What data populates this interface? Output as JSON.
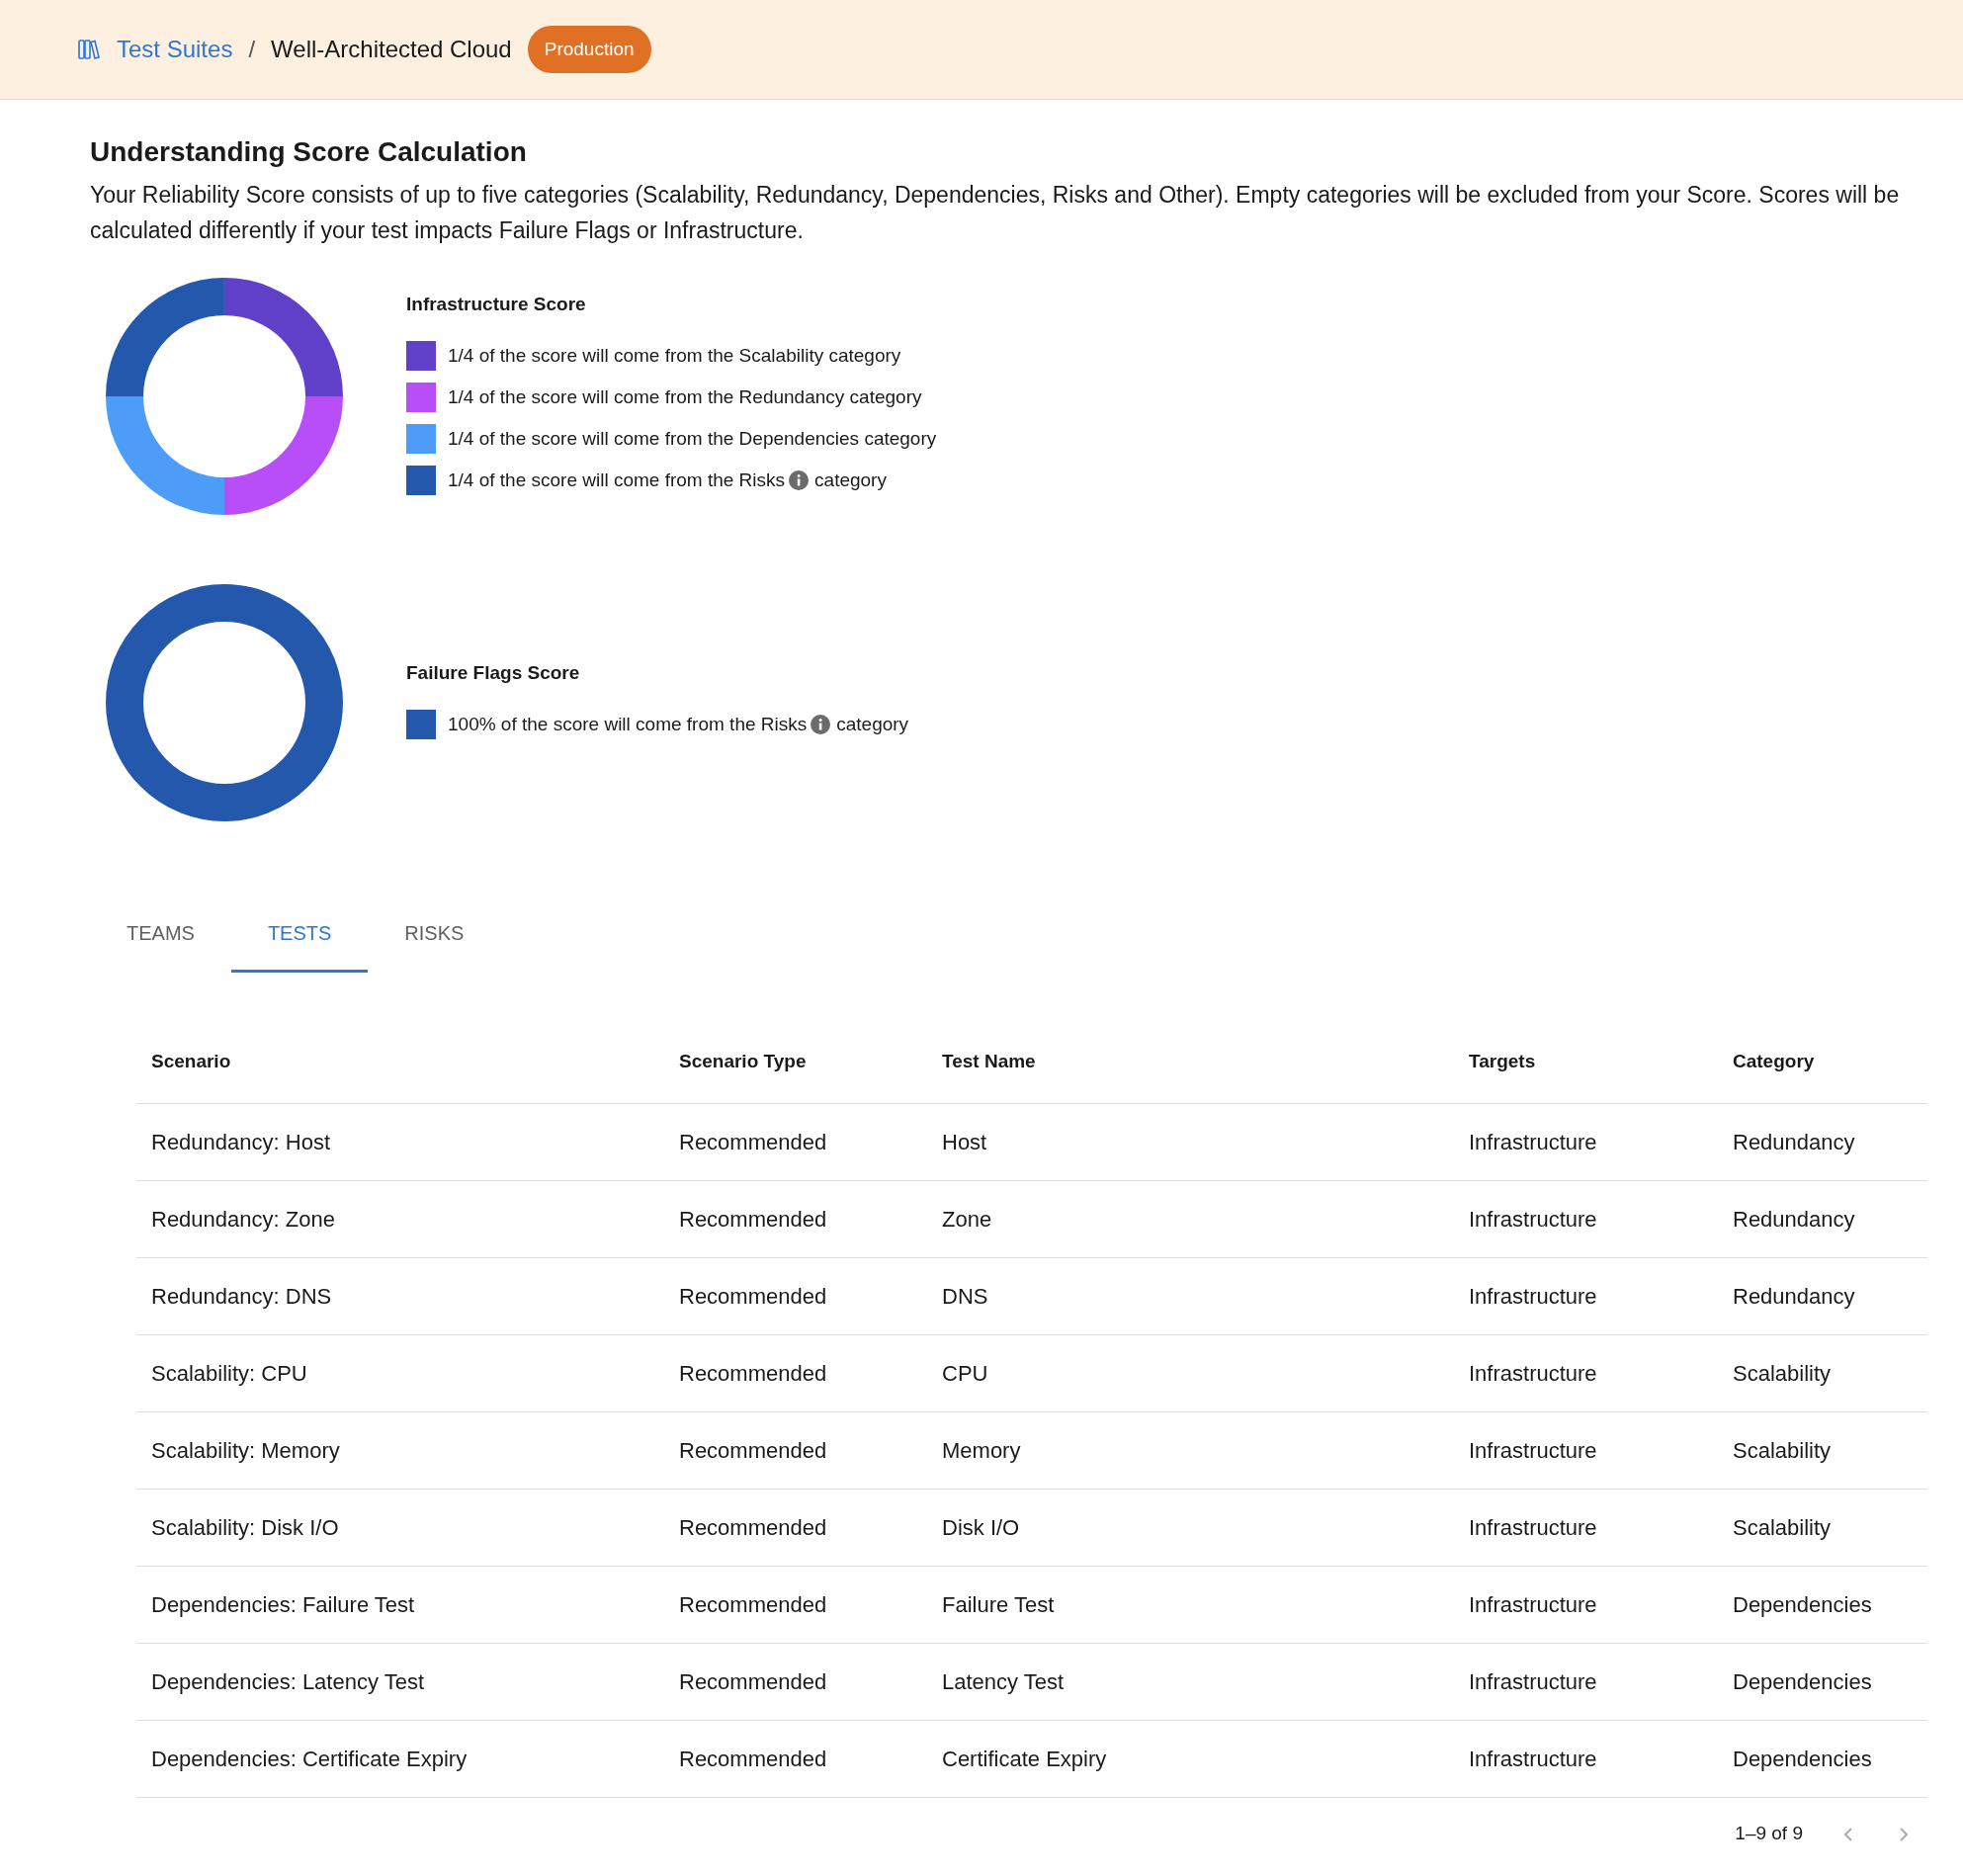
{
  "header": {
    "breadcrumb_link": "Test Suites",
    "separator": "/",
    "current": "Well-Architected Cloud",
    "badge": "Production"
  },
  "intro": {
    "title": "Understanding Score Calculation",
    "text": "Your Reliability Score consists of up to five categories (Scalability, Redundancy, Dependencies, Risks and Other). Empty categories will be excluded from your Score. Scores will be calculated differently if your test impacts Failure Flags or Infrastructure."
  },
  "scores": [
    {
      "title": "Infrastructure Score",
      "chart_data": {
        "type": "donut",
        "values": [
          25,
          25,
          25,
          25
        ]
      },
      "legend": [
        {
          "label": "1/4 of the score will come from the Scalability category",
          "info": false,
          "color": "#6040c8"
        },
        {
          "label": "1/4 of the score will come from the Redundancy category",
          "info": false,
          "color": "#b84ef8"
        },
        {
          "label": "1/4 of the score will come from the Dependencies category",
          "info": false,
          "color": "#4c9cf8"
        },
        {
          "label": "1/4 of the score will come from the Risks",
          "info": true,
          "label_after": "category",
          "color": "#2458ac"
        }
      ]
    },
    {
      "title": "Failure Flags Score",
      "legend": [
        {
          "label": "100% of the score will come from the Risks",
          "info": true,
          "label_after": "category",
          "color": "#2458ac"
        }
      ]
    }
  ],
  "tabs": [
    {
      "label": "TEAMS",
      "selected": false
    },
    {
      "label": "TESTS",
      "selected": true
    },
    {
      "label": "RISKS",
      "selected": false
    }
  ],
  "table": {
    "columns": [
      "Scenario",
      "Scenario Type",
      "Test Name",
      "Targets",
      "Category"
    ],
    "rows": [
      [
        "Redundancy: Host",
        "Recommended",
        "Host",
        "Infrastructure",
        "Redundancy"
      ],
      [
        "Redundancy: Zone",
        "Recommended",
        "Zone",
        "Infrastructure",
        "Redundancy"
      ],
      [
        "Redundancy: DNS",
        "Recommended",
        "DNS",
        "Infrastructure",
        "Redundancy"
      ],
      [
        "Scalability: CPU",
        "Recommended",
        "CPU",
        "Infrastructure",
        "Scalability"
      ],
      [
        "Scalability: Memory",
        "Recommended",
        "Memory",
        "Infrastructure",
        "Scalability"
      ],
      [
        "Scalability: Disk I/O",
        "Recommended",
        "Disk I/O",
        "Infrastructure",
        "Scalability"
      ],
      [
        "Dependencies: Failure Test",
        "Recommended",
        "Failure Test",
        "Infrastructure",
        "Dependencies"
      ],
      [
        "Dependencies: Latency Test",
        "Recommended",
        "Latency Test",
        "Infrastructure",
        "Dependencies"
      ],
      [
        "Dependencies: Certificate Expiry",
        "Recommended",
        "Certificate Expiry",
        "Infrastructure",
        "Dependencies"
      ]
    ]
  },
  "pagination": {
    "range": "1–9 of 9"
  }
}
